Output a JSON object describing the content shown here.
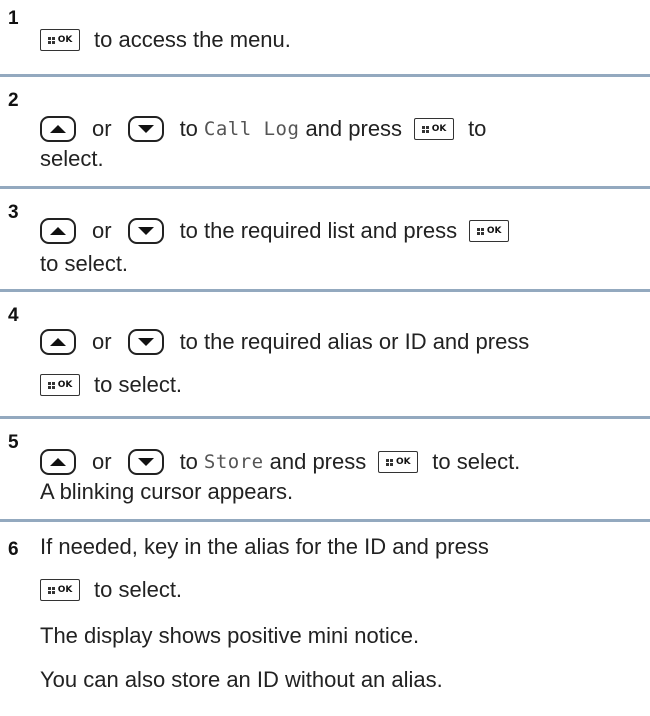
{
  "icons": {
    "ok_key": "menu-ok-key-icon",
    "up_key": "up-arrow-key-icon",
    "down_key": "down-arrow-key-icon",
    "ok_key_label": "OK"
  },
  "colors": {
    "divider": "#93a9bf",
    "text": "#222222"
  },
  "steps": [
    {
      "number": "1",
      "text": "to access the menu."
    },
    {
      "number": "2",
      "or": "or",
      "to": "to",
      "screen_item": "Call Log",
      "and_press": "and press",
      "to_tail": "to",
      "line2": "select."
    },
    {
      "number": "3",
      "or": "or",
      "text": "to the required list and press",
      "line2": "to select."
    },
    {
      "number": "4",
      "or": "or",
      "text": "to the required alias or ID and press",
      "line2": "to select."
    },
    {
      "number": "5",
      "or": "or",
      "to": "to",
      "screen_item": "Store",
      "and_press": "and press",
      "to_select": "to select.",
      "line2": "A blinking cursor appears."
    },
    {
      "number": "6",
      "text": "If needed, key in the alias for the ID and press",
      "line2": "to select.",
      "line3": "The display shows positive mini notice.",
      "line4": "You can also store an ID without an alias."
    }
  ]
}
